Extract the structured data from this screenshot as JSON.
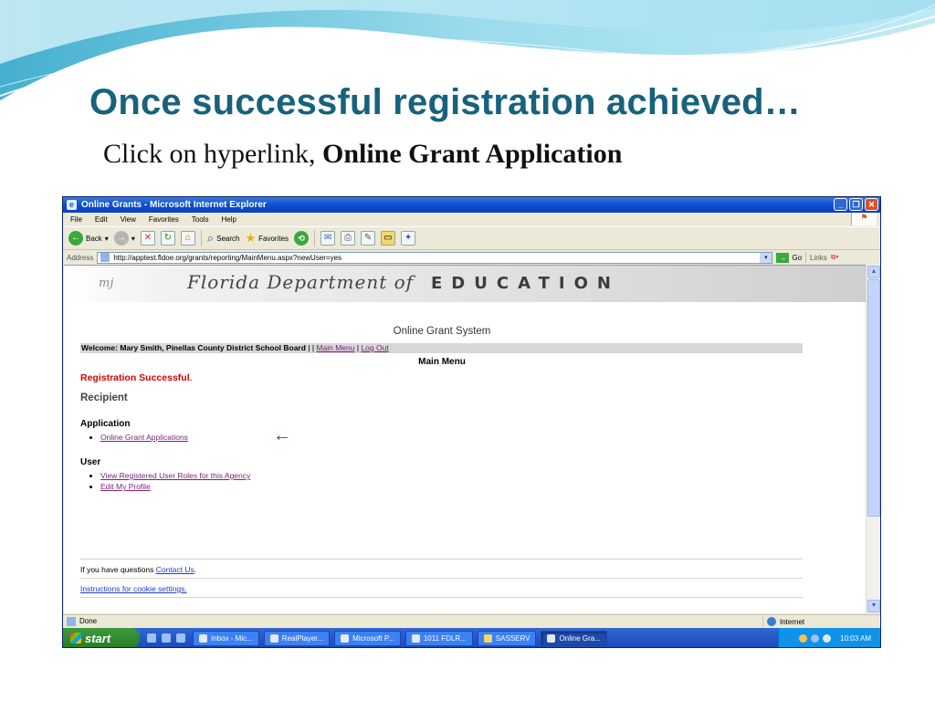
{
  "slide": {
    "title": "Once successful registration achieved…",
    "subtitle_prefix": "Click on hyperlink, ",
    "subtitle_bold": "Online Grant Application"
  },
  "window": {
    "title": "Online Grants - Microsoft Internet Explorer",
    "menu": [
      "File",
      "Edit",
      "View",
      "Favorites",
      "Tools",
      "Help"
    ],
    "toolbar": {
      "back": "Back",
      "search": "Search",
      "favorites": "Favorites"
    },
    "address": {
      "label": "Address",
      "url": "http://apptest.fldoe.org/grants/reporting/MainMenu.aspx?newUser=yes",
      "go": "Go",
      "links": "Links"
    },
    "status": {
      "text": "Done",
      "zone": "Internet"
    }
  },
  "page": {
    "banner": {
      "script_text": "Florida Department of",
      "edu_text": "EDUCATION",
      "logo_text": "mj"
    },
    "system_title": "Online Grant System",
    "welcome_prefix": "Welcome: Mary Smith, Pinellas County  District School Board",
    "welcome_sep1": " | | ",
    "main_menu_link": "Main Menu",
    "welcome_sep2": " | ",
    "log_out_link": "Log Out",
    "main_menu_title": "Main Menu",
    "registration_message": "Registration Successful",
    "registration_period": ".",
    "recipient_heading": "Recipient",
    "application_heading": "Application",
    "application_links": [
      "Online Grant Applications"
    ],
    "user_heading": "User",
    "user_links": [
      "View Registered User Roles for this Agency",
      "Edit My Profile"
    ],
    "pointer_arrow": "←",
    "questions_prefix": "If you have questions ",
    "contact_link": "Contact Us",
    "questions_suffix": ".",
    "cookie_link": "Instructions for cookie settings."
  },
  "taskbar": {
    "start": "start",
    "tasks": [
      "Inbox - Mic...",
      "RealPlayer...",
      "Microsoft P...",
      "1011 FDLR...",
      "SASSERV",
      "Online Gra..."
    ],
    "active_task_index": 5,
    "clock": "10:03 AM"
  },
  "colors": {
    "title_teal": "#17627d",
    "link_purple": "#7a1f7a",
    "success_red": "#d40000",
    "xp_blue": "#0a4fd1"
  }
}
